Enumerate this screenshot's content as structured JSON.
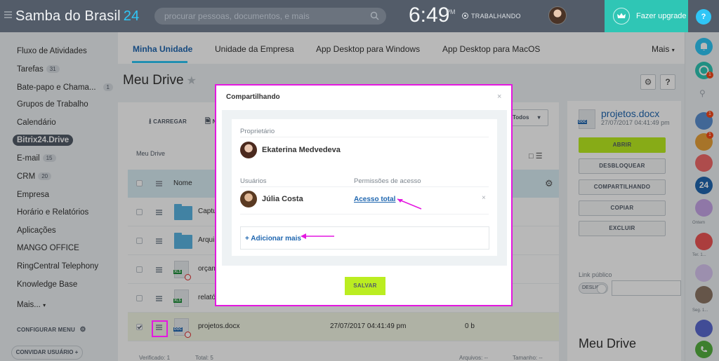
{
  "header": {
    "app_title": "Samba do Brasil",
    "app_number": "24",
    "search_placeholder": "procurar pessoas, documentos, e mais",
    "clock": "6:49",
    "clock_ampm": "PM",
    "work_status": "TRABALHANDO",
    "upgrade_label": "Fazer upgrade",
    "help_label": "?"
  },
  "sidebar": {
    "items": [
      {
        "label": "Fluxo de Atividades",
        "count": ""
      },
      {
        "label": "Tarefas",
        "count": "31"
      },
      {
        "label": "Bate-papo e Chama...",
        "count": "1"
      },
      {
        "label": "Grupos de Trabalho",
        "count": ""
      },
      {
        "label": "Calendário",
        "count": ""
      },
      {
        "label": "Bitrix24.Drive",
        "count": ""
      },
      {
        "label": "E-mail",
        "count": "15"
      },
      {
        "label": "CRM",
        "count": "20"
      },
      {
        "label": "Empresa",
        "count": ""
      },
      {
        "label": "Horário e Relatórios",
        "count": ""
      },
      {
        "label": "Aplicações",
        "count": ""
      },
      {
        "label": "MANGO OFFICE",
        "count": ""
      },
      {
        "label": "RingCentral Telephony",
        "count": ""
      },
      {
        "label": "Knowledge Base",
        "count": ""
      },
      {
        "label": "Mais...",
        "count": ""
      }
    ],
    "configure_menu": "CONFIGURAR MENU",
    "invite_users": "CONVIDAR USUÁRIO"
  },
  "tabs": [
    {
      "label": "Minha Unidade",
      "active": true
    },
    {
      "label": "Unidade da Empresa",
      "active": false
    },
    {
      "label": "App Desktop para Windows",
      "active": false
    },
    {
      "label": "App Desktop para MacOS",
      "active": false
    },
    {
      "label": "Mais",
      "active": false
    }
  ],
  "page": {
    "title": "Meu Drive",
    "upload_label": "CARREGAR",
    "upload_second": "N",
    "filter_label": "Todos",
    "breadcrumb": "Meu Drive",
    "name_header": "Nome"
  },
  "files": [
    {
      "name": "Captu",
      "type": "folder",
      "date": "",
      "size": ""
    },
    {
      "name": "Arqui",
      "type": "folder",
      "date": "",
      "size": ""
    },
    {
      "name": "orçam",
      "type": "xls",
      "date": "",
      "size": ""
    },
    {
      "name": "relató",
      "type": "xls",
      "date": "",
      "size": ""
    },
    {
      "name": "projetos.docx",
      "type": "doc",
      "date": "27/07/2017 04:41:49 pm",
      "size": "0 b"
    }
  ],
  "footer": {
    "selected_label": "Verificado: 1",
    "total_label": "Total: 5",
    "files_label": "Arquivos: --",
    "size_label": "Tamanho: --"
  },
  "right_panel": {
    "file_name": "projetos.docx",
    "file_date": "27/07/2017 04:41:49 pm",
    "btn_open": "ABRIR",
    "btn_unlock": "DESBLOQUEAR",
    "btn_share": "COMPARTILHANDO",
    "btn_copy": "COPIAR",
    "btn_delete": "EXCLUIR",
    "public_link_label": "Link público",
    "toggle_label": "DESLIG",
    "drive_title": "Meu Drive"
  },
  "messenger": {
    "label_yesterday": "Ontem",
    "label_tue": "Ter. 1...",
    "label_sat": "Seg. 1..."
  },
  "modal": {
    "title": "Compartilhando",
    "owner_label": "Proprietário",
    "owner_name": "Ekaterina Medvedeva",
    "users_label": "Usuários",
    "permissions_label": "Permissões de acesso",
    "user_name": "Júlia Costa",
    "permission_value": "Acesso total",
    "add_more": "+ Adicionar mais",
    "save_label": "SALVAR"
  },
  "colors": {
    "topbar": "#535c69",
    "accent_blue": "#2fc6f6",
    "upgrade": "#2fc6b5",
    "primary_green": "#bbed21",
    "highlight_magenta": "#e417e0",
    "link_blue": "#2067b0"
  }
}
